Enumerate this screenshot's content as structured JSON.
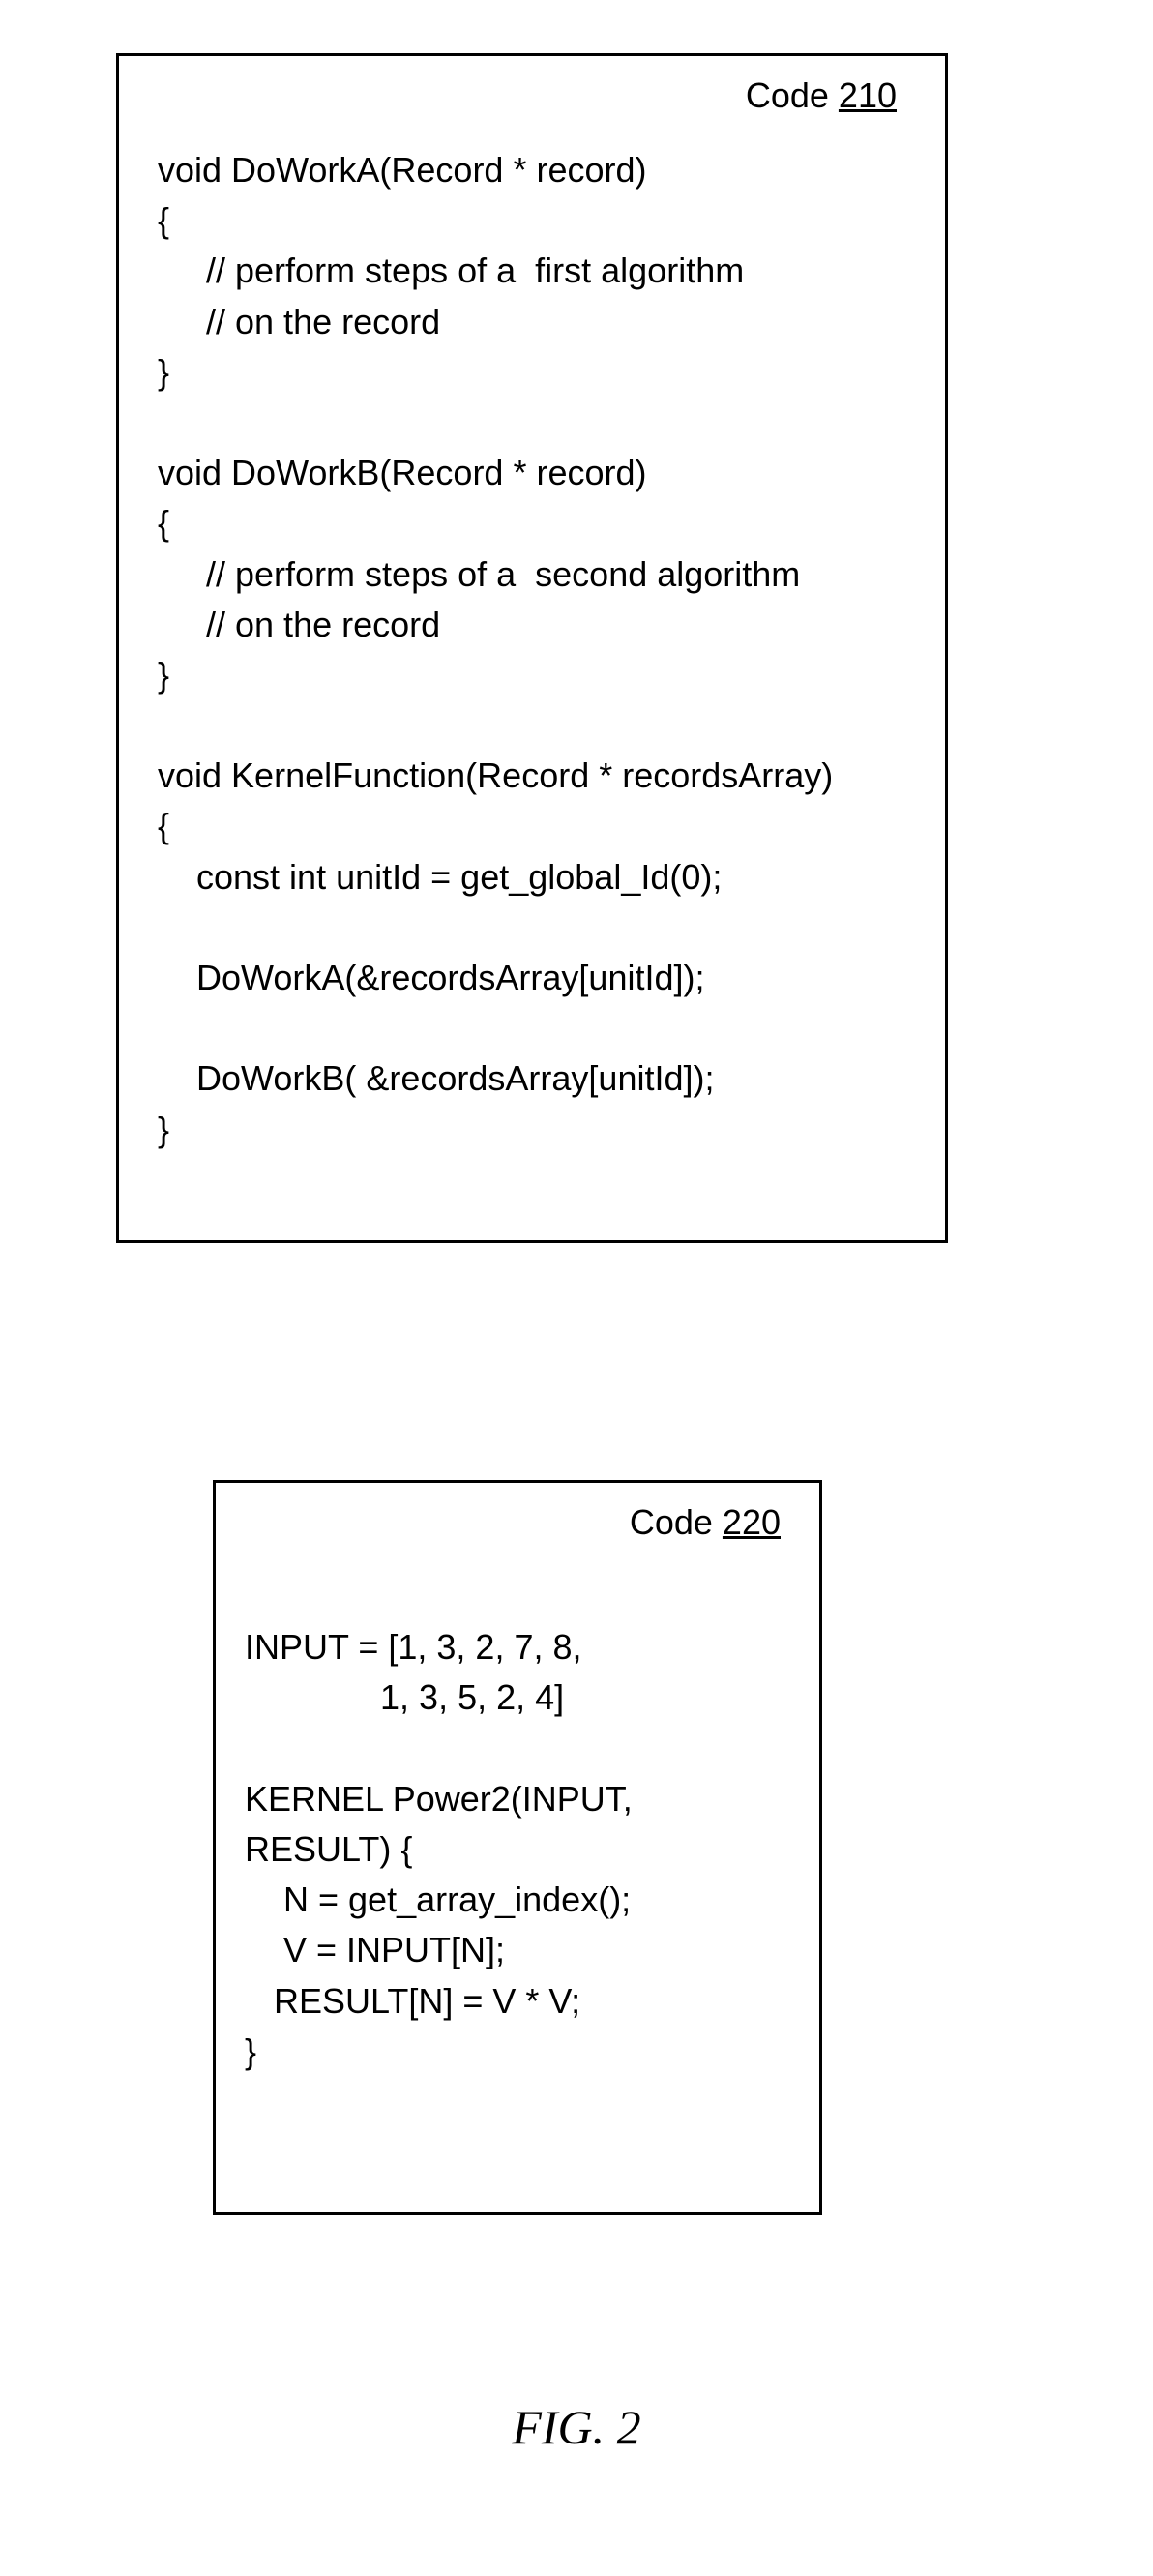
{
  "box210": {
    "label_prefix": "Code ",
    "label_num": "210",
    "code": "void DoWorkA(Record * record)\n{\n     // perform steps of a  first algorithm\n     // on the record\n}\n\nvoid DoWorkB(Record * record)\n{\n     // perform steps of a  second algorithm\n     // on the record\n}\n\nvoid KernelFunction(Record * recordsArray)\n{\n    const int unitId = get_global_Id(0);\n\n    DoWorkA(&recordsArray[unitId]);\n\n    DoWorkB( &recordsArray[unitId]);\n}"
  },
  "box220": {
    "label_prefix": "Code ",
    "label_num": "220",
    "code": "\nINPUT = [1, 3, 2, 7, 8,\n              1, 3, 5, 2, 4]\n\nKERNEL Power2(INPUT,\nRESULT) {\n    N = get_array_index();\n    V = INPUT[N];\n   RESULT[N] = V * V;\n}"
  },
  "figure_label": "FIG. 2"
}
